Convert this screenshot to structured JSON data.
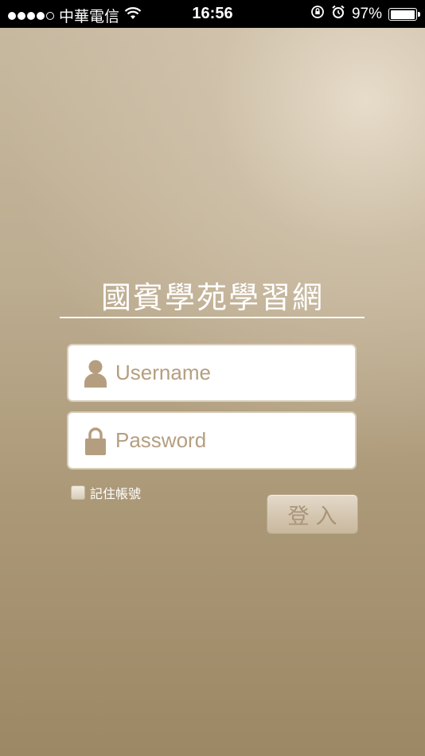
{
  "status_bar": {
    "carrier": "中華電信",
    "time": "16:56",
    "battery": "97%",
    "battery_level": 0.97,
    "signal_bars": 4,
    "signal_max": 5
  },
  "app": {
    "title": "國賓學苑學習網"
  },
  "login": {
    "username_placeholder": "Username",
    "password_placeholder": "Password",
    "remember_label": "記住帳號",
    "submit_label": "登入"
  },
  "icons": {
    "user": "user-icon",
    "lock": "lock-icon",
    "wifi": "wifi-icon",
    "rotation_lock": "rotation-lock-icon",
    "alarm": "alarm-icon"
  },
  "colors": {
    "accent": "#b59e80",
    "background_top": "#c7b9a0",
    "background_bottom": "#9d8865"
  }
}
